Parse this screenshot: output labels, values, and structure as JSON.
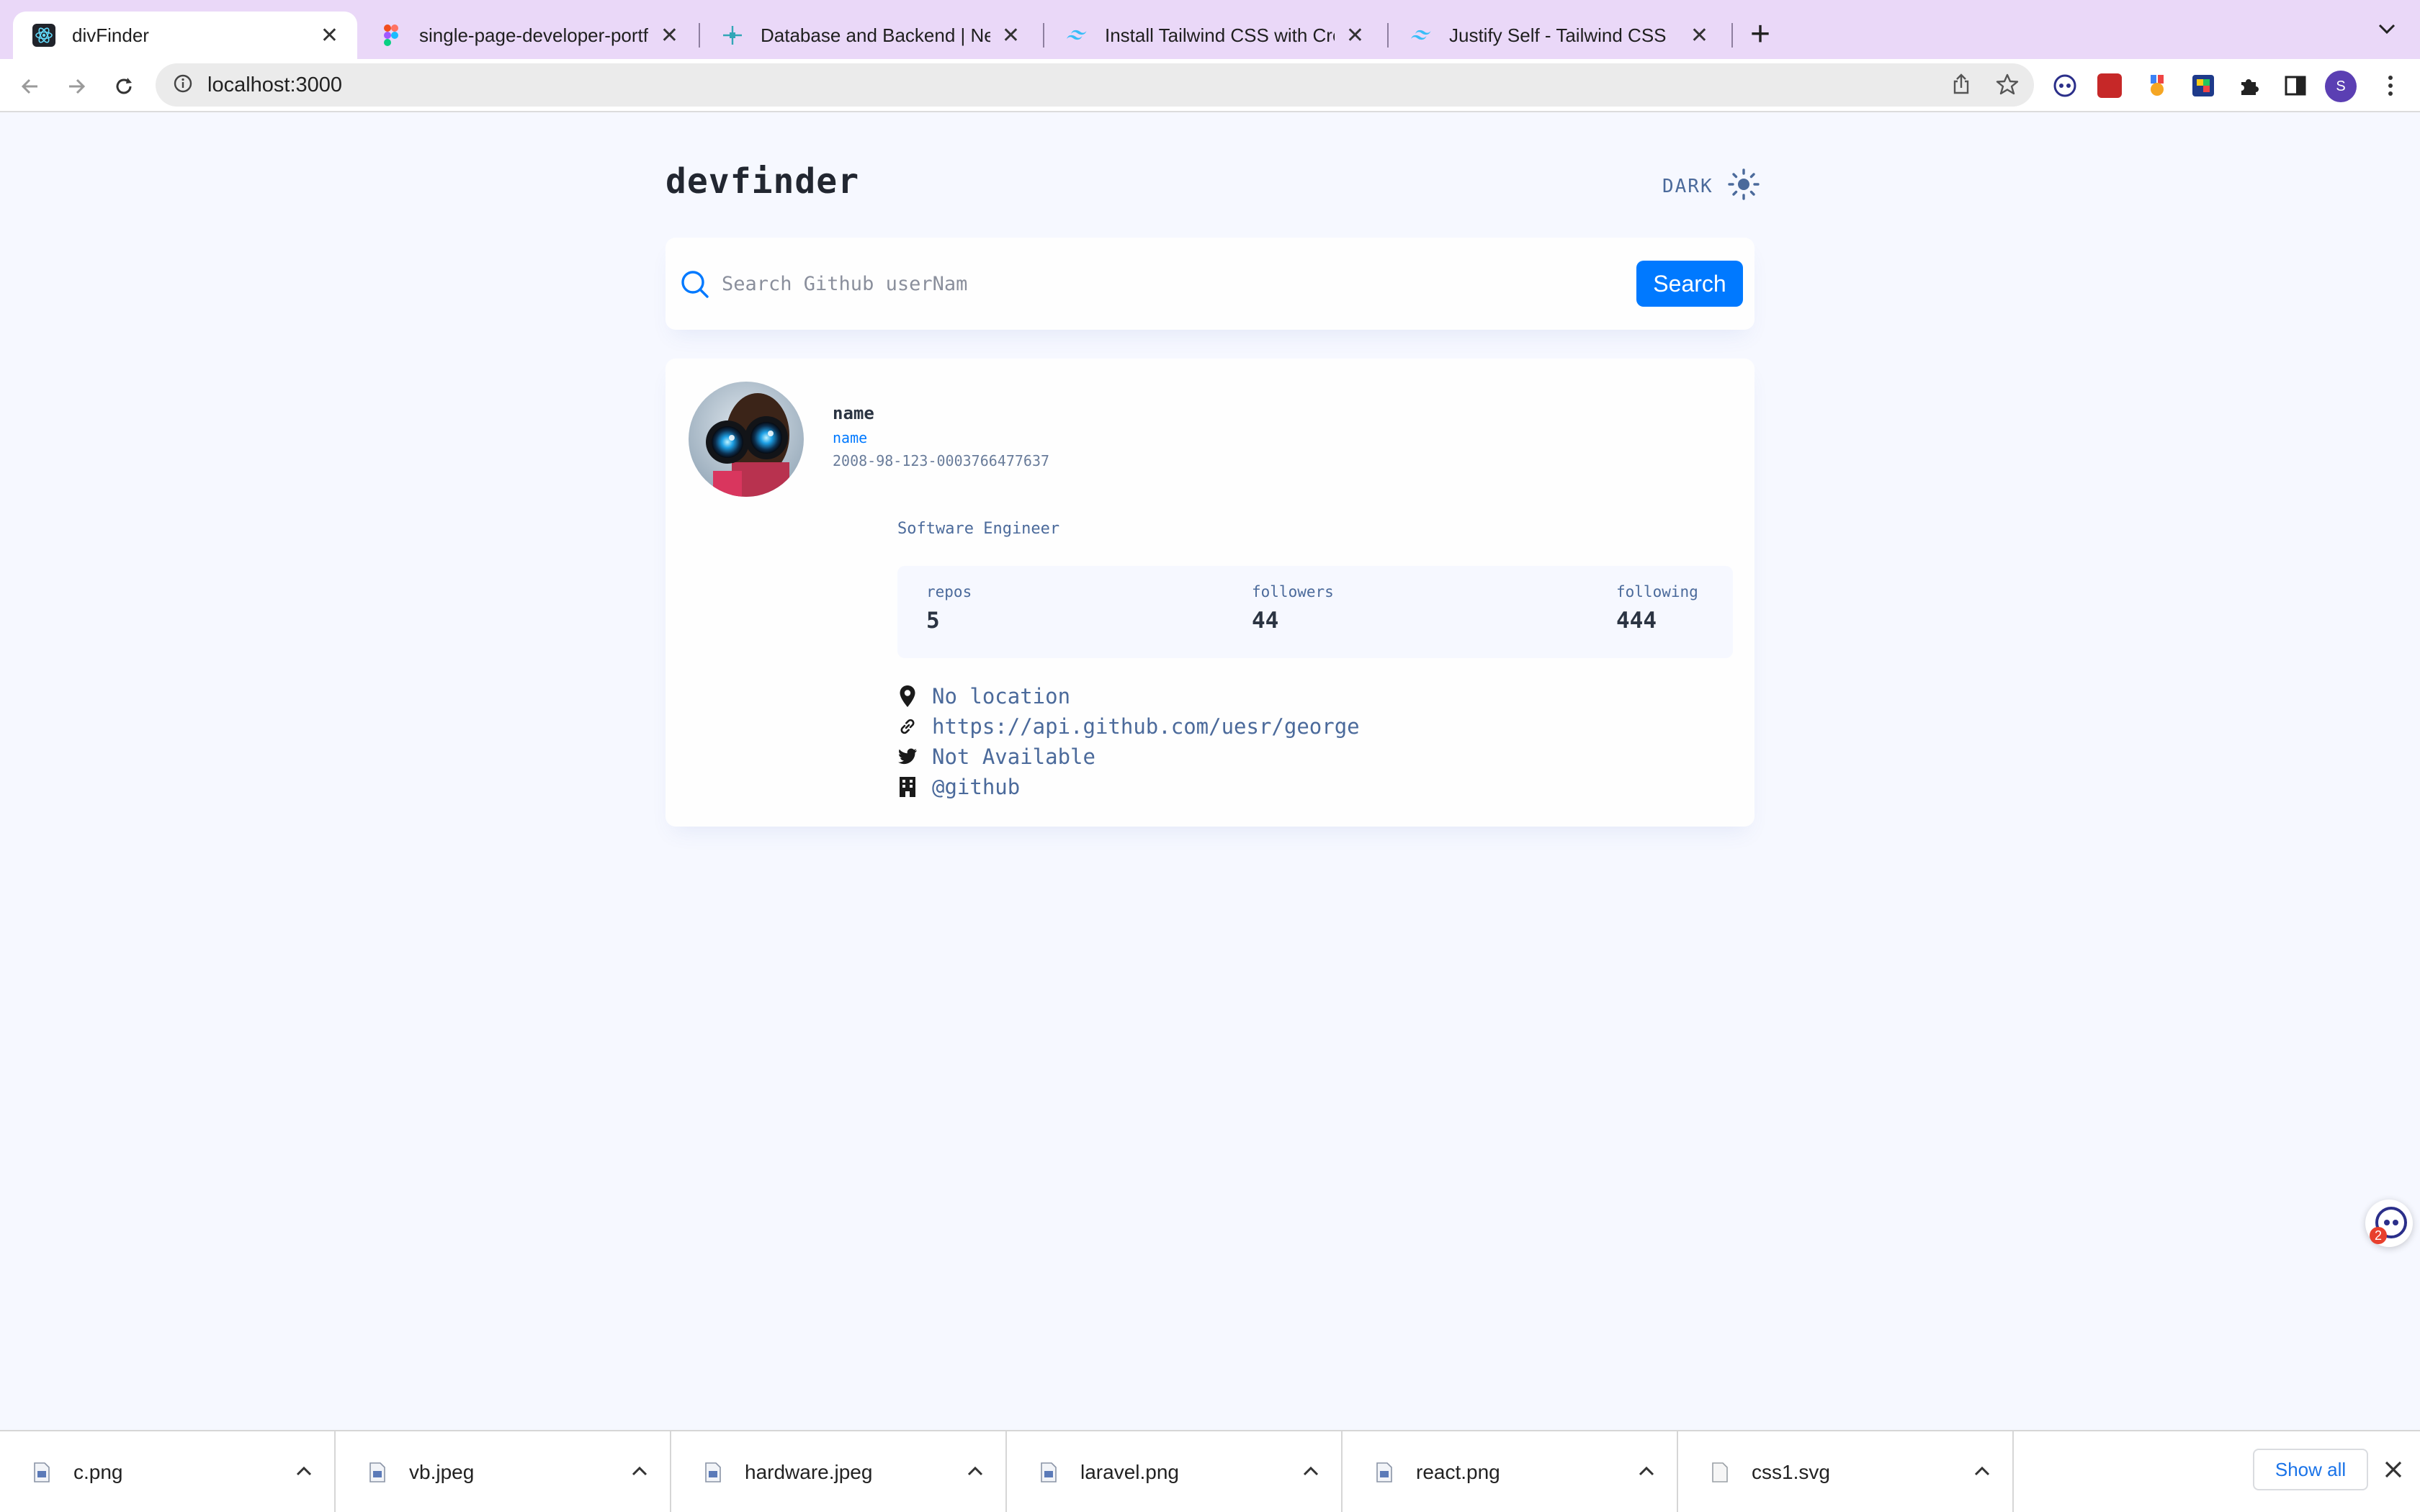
{
  "browser": {
    "tabs": [
      {
        "title": "divFinder",
        "icon": "react-icon",
        "active": true
      },
      {
        "title": "single-page-developer-portfoli",
        "icon": "figma-icon",
        "active": false
      },
      {
        "title": "Database and Backend | Netlify",
        "icon": "netlify-icon",
        "active": false
      },
      {
        "title": "Install Tailwind CSS with Create",
        "icon": "tailwind-icon",
        "active": false
      },
      {
        "title": "Justify Self - Tailwind CSS",
        "icon": "tailwind-icon",
        "active": false
      }
    ],
    "new_tab_label": "+",
    "url": "localhost:3000",
    "profile_initial": "S"
  },
  "header": {
    "logo": "devfinder",
    "theme_toggle_label": "DARK"
  },
  "search": {
    "placeholder": "Search Github userNam",
    "value": "",
    "button_label": "Search"
  },
  "profile": {
    "name": "name",
    "login": "name",
    "joined": "2008-98-123-0003766477637",
    "bio": "Software Engineer",
    "stats": [
      {
        "label": "repos",
        "value": "5"
      },
      {
        "label": "followers",
        "value": "44"
      },
      {
        "label": "following",
        "value": "444"
      }
    ],
    "links": [
      {
        "icon": "location-pin-icon",
        "text": "No location"
      },
      {
        "icon": "link-icon",
        "text": "https://api.github.com/uesr/george"
      },
      {
        "icon": "twitter-icon",
        "text": "Not Available"
      },
      {
        "icon": "company-building-icon",
        "text": "@github"
      }
    ]
  },
  "floating_widget": {
    "badge_count": "2"
  },
  "downloads": {
    "items": [
      {
        "name": "c.png"
      },
      {
        "name": "vb.jpeg"
      },
      {
        "name": "hardware.jpeg"
      },
      {
        "name": "laravel.png"
      },
      {
        "name": "react.png"
      },
      {
        "name": "css1.svg"
      }
    ],
    "show_all_label": "Show all"
  },
  "colors": {
    "accent": "#0079ff",
    "page_bg": "#f6f8ff",
    "card_bg": "#fefefe",
    "muted_text": "#4b6a9b",
    "tabbar_bg": "#ead8f8"
  }
}
